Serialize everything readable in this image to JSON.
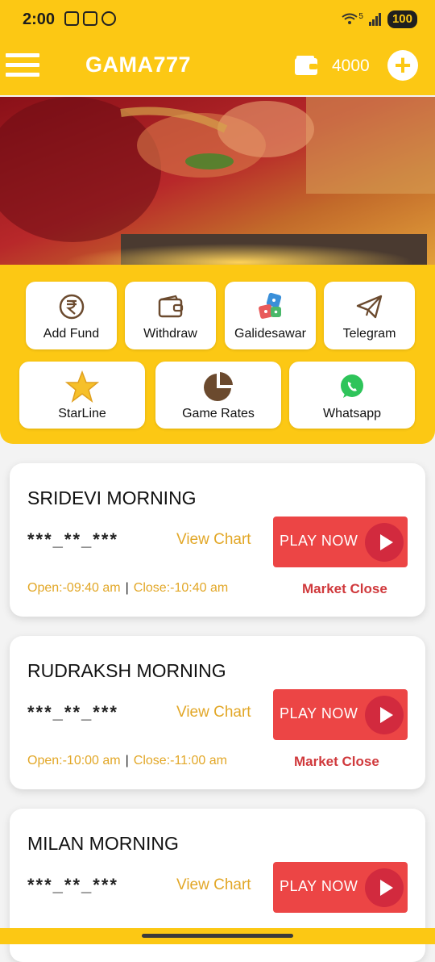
{
  "status_bar": {
    "time": "2:00",
    "battery": "100",
    "network": "5"
  },
  "app_bar": {
    "title": "GAMA777",
    "balance": "4000",
    "add_symbol": "+"
  },
  "quick_actions": [
    {
      "label": "Add Fund",
      "icon": "rupee-icon"
    },
    {
      "label": "Withdraw",
      "icon": "wallet-icon"
    },
    {
      "label": "Galidesawar",
      "icon": "dice-icon"
    },
    {
      "label": "Telegram",
      "icon": "telegram-icon"
    },
    {
      "label": "StarLine",
      "icon": "star-icon"
    },
    {
      "label": "Game Rates",
      "icon": "pie-chart-icon"
    },
    {
      "label": "Whatsapp",
      "icon": "whatsapp-icon"
    }
  ],
  "markets": [
    {
      "name": "SRIDEVI MORNING",
      "result": "***_**_***",
      "view_chart": "View Chart",
      "play": "PLAY NOW",
      "open": "Open:-09:40 am",
      "close": "Close:-10:40 am",
      "status": "Market Close"
    },
    {
      "name": "RUDRAKSH MORNING",
      "result": "***_**_***",
      "view_chart": "View Chart",
      "play": "PLAY NOW",
      "open": "Open:-10:00 am",
      "close": "Close:-11:00 am",
      "status": "Market Close"
    },
    {
      "name": "MILAN MORNING",
      "result": "***_**_***",
      "view_chart": "View Chart",
      "play": "PLAY NOW",
      "open": "",
      "close": "",
      "status": ""
    }
  ],
  "colors": {
    "brand": "#fcc814",
    "play": "#ec4545",
    "accent_text": "#e2a727",
    "status": "#d0393c"
  }
}
